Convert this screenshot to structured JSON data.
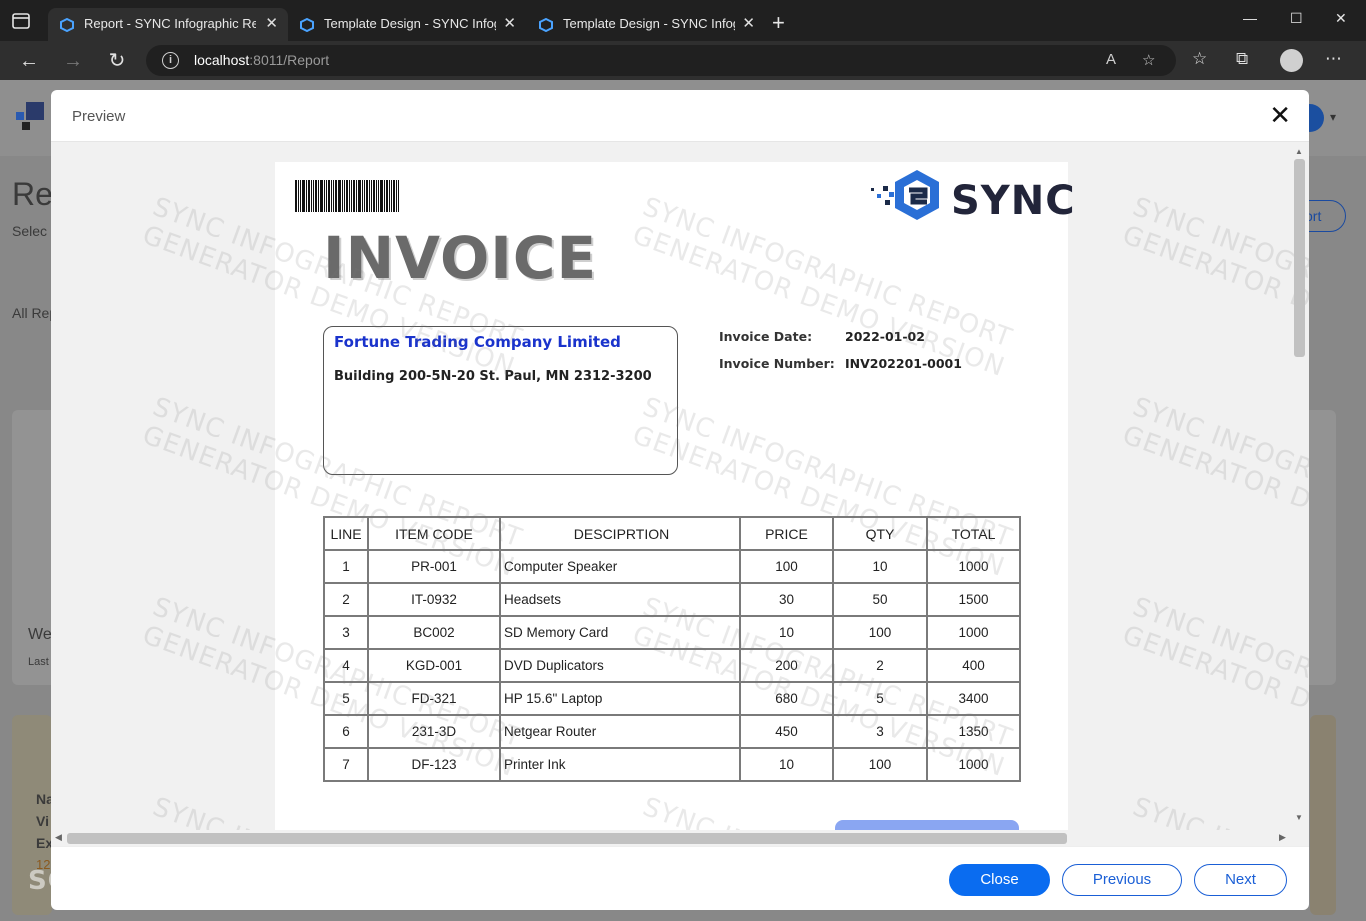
{
  "browser": {
    "tabs": [
      {
        "title": "Report - SYNC Infographic Report",
        "active": true
      },
      {
        "title": "Template Design - SYNC Infographic",
        "active": false
      },
      {
        "title": "Template Design - SYNC Infographic",
        "active": false
      }
    ],
    "url_host": "localhost",
    "url_rest": ":8011/Report"
  },
  "background": {
    "heading": "Re",
    "subheading": "Selec",
    "all_reports": "All Rep",
    "card_title": "We",
    "card_sub": "Last",
    "export_button": "ort",
    "thumb_lines": [
      "Na",
      "Vi",
      "Ex",
      "12"
    ]
  },
  "modal": {
    "title": "Preview",
    "buttons": {
      "close": "Close",
      "previous": "Previous",
      "next": "Next"
    }
  },
  "invoice": {
    "title": "INVOICE",
    "logo_text": "SYNC",
    "company_name": "Fortune Trading Company Limited",
    "company_address": "Building 200-5N-20 St. Paul, MN 2312-3200",
    "date_label": "Invoice Date:",
    "date_value": "2022-01-02",
    "number_label": "Invoice Number:",
    "number_value": "INV202201-0001",
    "table_headers": {
      "line": "LINE",
      "code": "ITEM CODE",
      "desc": "DESCIPRTION",
      "price": "PRICE",
      "qty": "QTY",
      "total": "TOTAL"
    },
    "rows": [
      {
        "line": "1",
        "code": "PR-001",
        "desc": "Computer Speaker",
        "price": "100",
        "qty": "10",
        "total": "1000"
      },
      {
        "line": "2",
        "code": "IT-0932",
        "desc": "Headsets",
        "price": "30",
        "qty": "50",
        "total": "1500"
      },
      {
        "line": "3",
        "code": "BC002",
        "desc": "SD Memory Card",
        "price": "10",
        "qty": "100",
        "total": "1000"
      },
      {
        "line": "4",
        "code": "KGD-001",
        "desc": "DVD Duplicators",
        "price": "200",
        "qty": "2",
        "total": "400"
      },
      {
        "line": "5",
        "code": "FD-321",
        "desc": "HP 15.6\" Laptop",
        "price": "680",
        "qty": "5",
        "total": "3400"
      },
      {
        "line": "6",
        "code": "231-3D",
        "desc": "Netgear Router",
        "price": "450",
        "qty": "3",
        "total": "1350"
      },
      {
        "line": "7",
        "code": "DF-123",
        "desc": "Printer Ink",
        "price": "10",
        "qty": "100",
        "total": "1000"
      }
    ]
  },
  "watermark": {
    "line1": "SYNC INFOGRAPHIC REPORT",
    "line2": "GENERATOR DEMO VERSION"
  },
  "overlay": {
    "softpedia": "SOFTPEDIA"
  }
}
